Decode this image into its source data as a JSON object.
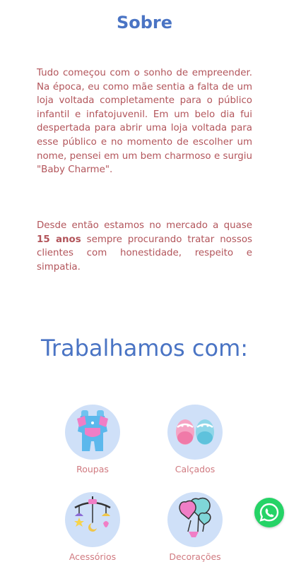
{
  "about": {
    "title": "Sobre",
    "paragraph1": "Tudo começou com o sonho de empreender. Na época, eu como mãe sentia a falta de um loja voltada completamente para o público infantil e infatojuvenil. Em um belo dia fui despertada para abrir uma loja voltada para esse público e no momento de escolher um nome, pensei em um bem charmoso e surgiu \"Baby Charme\".",
    "paragraph2_before": "Desde então estamos no mercado a quase ",
    "paragraph2_bold": "15 anos",
    "paragraph2_after": " sempre procurando tratar nossos clientes com honestidade, respeito e simpatia."
  },
  "works": {
    "title": "Trabalhamos com:",
    "categories": [
      {
        "label": "Roupas",
        "icon": "baby-clothes-icon"
      },
      {
        "label": "Calçados",
        "icon": "baby-shoes-icon"
      },
      {
        "label": "Acessórios",
        "icon": "baby-mobile-icon"
      },
      {
        "label": "Decorações",
        "icon": "balloons-icon"
      }
    ]
  },
  "whatsapp": {
    "icon": "whatsapp-icon"
  },
  "colors": {
    "title_blue": "#4a74c4",
    "text_rose": "#b2545a",
    "label_pink": "#d07a80",
    "circle_bg": "#cfe0f8",
    "whatsapp_green": "#25d366"
  }
}
